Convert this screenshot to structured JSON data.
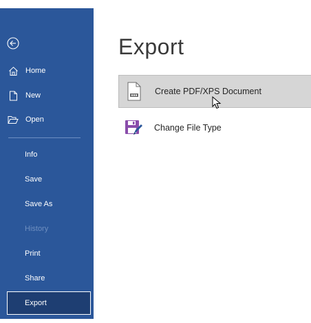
{
  "sidebar": {
    "back_icon": "back-arrow-circle-icon",
    "top_items": [
      {
        "label": "Home",
        "icon": "home-icon"
      },
      {
        "label": "New",
        "icon": "new-document-icon"
      },
      {
        "label": "Open",
        "icon": "open-folder-icon"
      }
    ],
    "items": [
      {
        "label": "Info",
        "state": "normal"
      },
      {
        "label": "Save",
        "state": "normal"
      },
      {
        "label": "Save As",
        "state": "normal"
      },
      {
        "label": "History",
        "state": "disabled"
      },
      {
        "label": "Print",
        "state": "normal"
      },
      {
        "label": "Share",
        "state": "normal"
      },
      {
        "label": "Export",
        "state": "selected"
      }
    ],
    "colors": {
      "background": "#2b579a",
      "selected_background": "#1e3e72",
      "disabled_text": "#6f8fc0"
    }
  },
  "main": {
    "title": "Export",
    "options": [
      {
        "label": "Create PDF/XPS Document",
        "icon": "pdf-document-icon",
        "highlighted": true
      },
      {
        "label": "Change File Type",
        "icon": "save-as-file-type-icon",
        "highlighted": false
      }
    ]
  }
}
